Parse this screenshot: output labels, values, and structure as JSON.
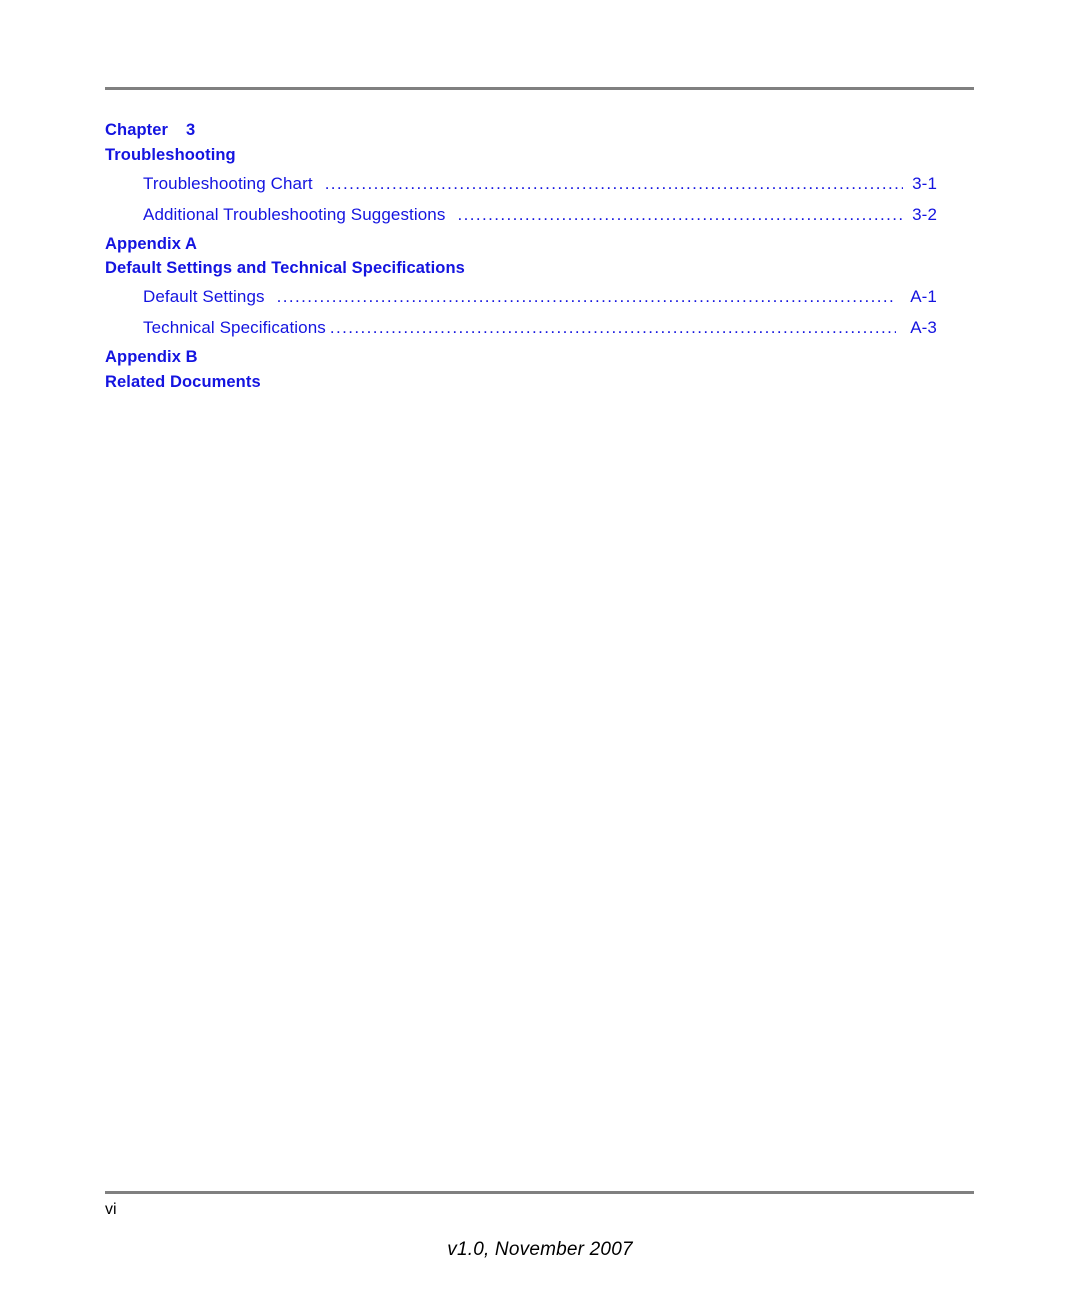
{
  "document": {
    "page_type": "table-of-contents",
    "folio": "vi",
    "version_line": "v1.0, November 2007",
    "colors": {
      "link_blue": "#1414E0",
      "rule_gray": "#808080",
      "text_black": "#000000"
    }
  },
  "toc": {
    "groups": [
      {
        "head_label": "Chapter",
        "head_number": "3",
        "title": "Troubleshooting",
        "entries": [
          {
            "label": "Troubleshooting Chart",
            "page": "3-1"
          },
          {
            "label": "Additional Troubleshooting Suggestions",
            "page": "3-2"
          }
        ]
      },
      {
        "head_label": "Appendix A",
        "head_number": "",
        "title": "Default Settings and Technical Specifications",
        "entries": [
          {
            "label": "Default Settings",
            "page": "A-1"
          },
          {
            "label": "Technical Specifications",
            "page": "A-3"
          }
        ]
      },
      {
        "head_label": "Appendix B",
        "head_number": "",
        "title": "Related Documents",
        "entries": []
      }
    ]
  }
}
